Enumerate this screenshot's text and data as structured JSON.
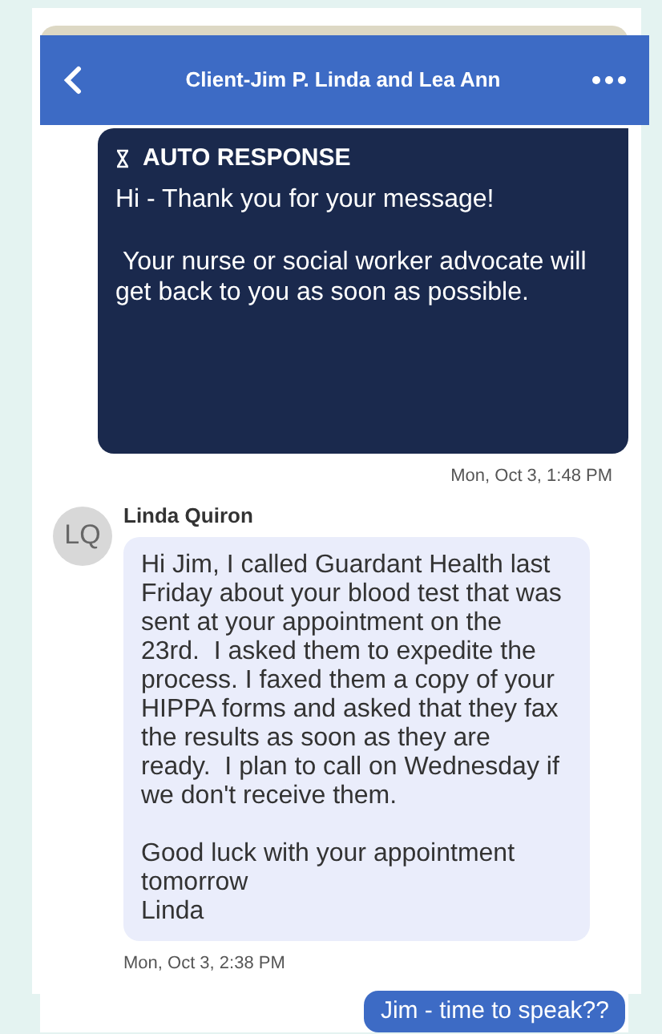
{
  "header": {
    "title": "Client-Jim P. Linda and Lea Ann"
  },
  "messages": [
    {
      "kind": "auto",
      "title": "AUTO RESPONSE",
      "lines": [
        "Hi - Thank you for your message!",
        " Your nurse or social worker advocate will get back to you as soon as possible."
      ],
      "time": "Mon, Oct 3, 1:48 PM"
    },
    {
      "kind": "incoming",
      "initials": "LQ",
      "sender": "Linda Quiron",
      "lines": [
        "Hi Jim, I called Guardant Health last Friday about your blood test that was sent at your appointment on the 23rd.  I asked them to expedite the process. I faxed them a copy of your HIPPA forms and asked that they fax the results as soon as they are ready.  I plan to call on Wednesday if we don't receive them.",
        "Good luck with your appointment tomorrow\nLinda"
      ],
      "time": "Mon, Oct 3, 2:38 PM"
    },
    {
      "kind": "outgoing",
      "lines": [
        "Jim - time to speak??"
      ]
    }
  ]
}
